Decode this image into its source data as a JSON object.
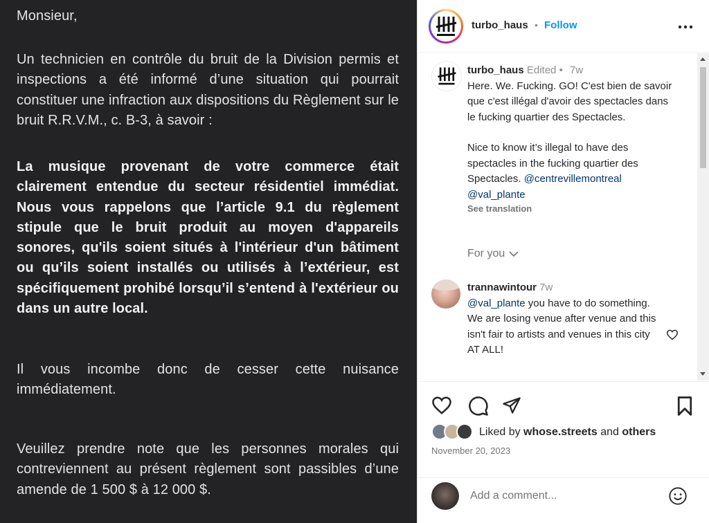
{
  "document": {
    "greeting": "Monsieur,",
    "para1": "Un technicien en contrôle du bruit de la Division permis et inspections a été informé d’une situation qui pourrait constituer une infraction aux dispositions du Règlement sur le bruit R.R.V.M., c. B-3, à savoir :",
    "para2": "La musique provenant de votre commerce était clairement entendue du secteur résidentiel immédiat. Nous vous rappelons que l’article 9.1 du règlement stipule que le bruit produit au moyen d'appareils sonores, qu'ils soient situés à l'intérieur d'un bâtiment ou qu’ils soient installés ou utilisés à l’extérieur, est spécifiquement prohibé lorsqu’il s’entend à l'extérieur ou dans un autre local.",
    "para3": "Il vous incombe donc de cesser cette nuisance immédiatement.",
    "para4": "Veuillez prendre note que les personnes morales qui contreviennent au présent règlement sont passibles d’une amende de 1 500 $ à 12 000 $."
  },
  "header": {
    "username": "turbo_haus",
    "separator": "•",
    "follow_label": "Follow",
    "more_icon": "more-horizontal-icon"
  },
  "caption": {
    "username": "turbo_haus",
    "edited": "Edited",
    "separator": "•",
    "time": "7w",
    "text_fr": "Here. We. Fucking. GO! C'est bien de savoir que c'est illégal d'avoir des spectacles dans le fucking quartier des Spectacles.",
    "text_en": "Nice to know it’s illegal to have des spectacles in the fucking quartier des Spectacles.",
    "mention1": "@centrevillemontreal",
    "mention2": "@val_plante",
    "see_translation": "See translation",
    "for_you": "For you"
  },
  "comment1": {
    "username": "trannawintour",
    "time": "7w",
    "mention": "@val_plante",
    "text": "you have to do something. We are losing venue after venue and this isn't fair to artists and venues in this city AT ALL!"
  },
  "likes": {
    "prefix": "Liked by",
    "user": "whose.streets",
    "and": "and",
    "others": "others"
  },
  "date": "November 20, 2023",
  "add_comment": {
    "placeholder": "Add a comment..."
  },
  "colors": {
    "image_bg": "#232325",
    "follow": "#0095f6",
    "mention": "#00376b",
    "muted": "#8e8e8e"
  }
}
